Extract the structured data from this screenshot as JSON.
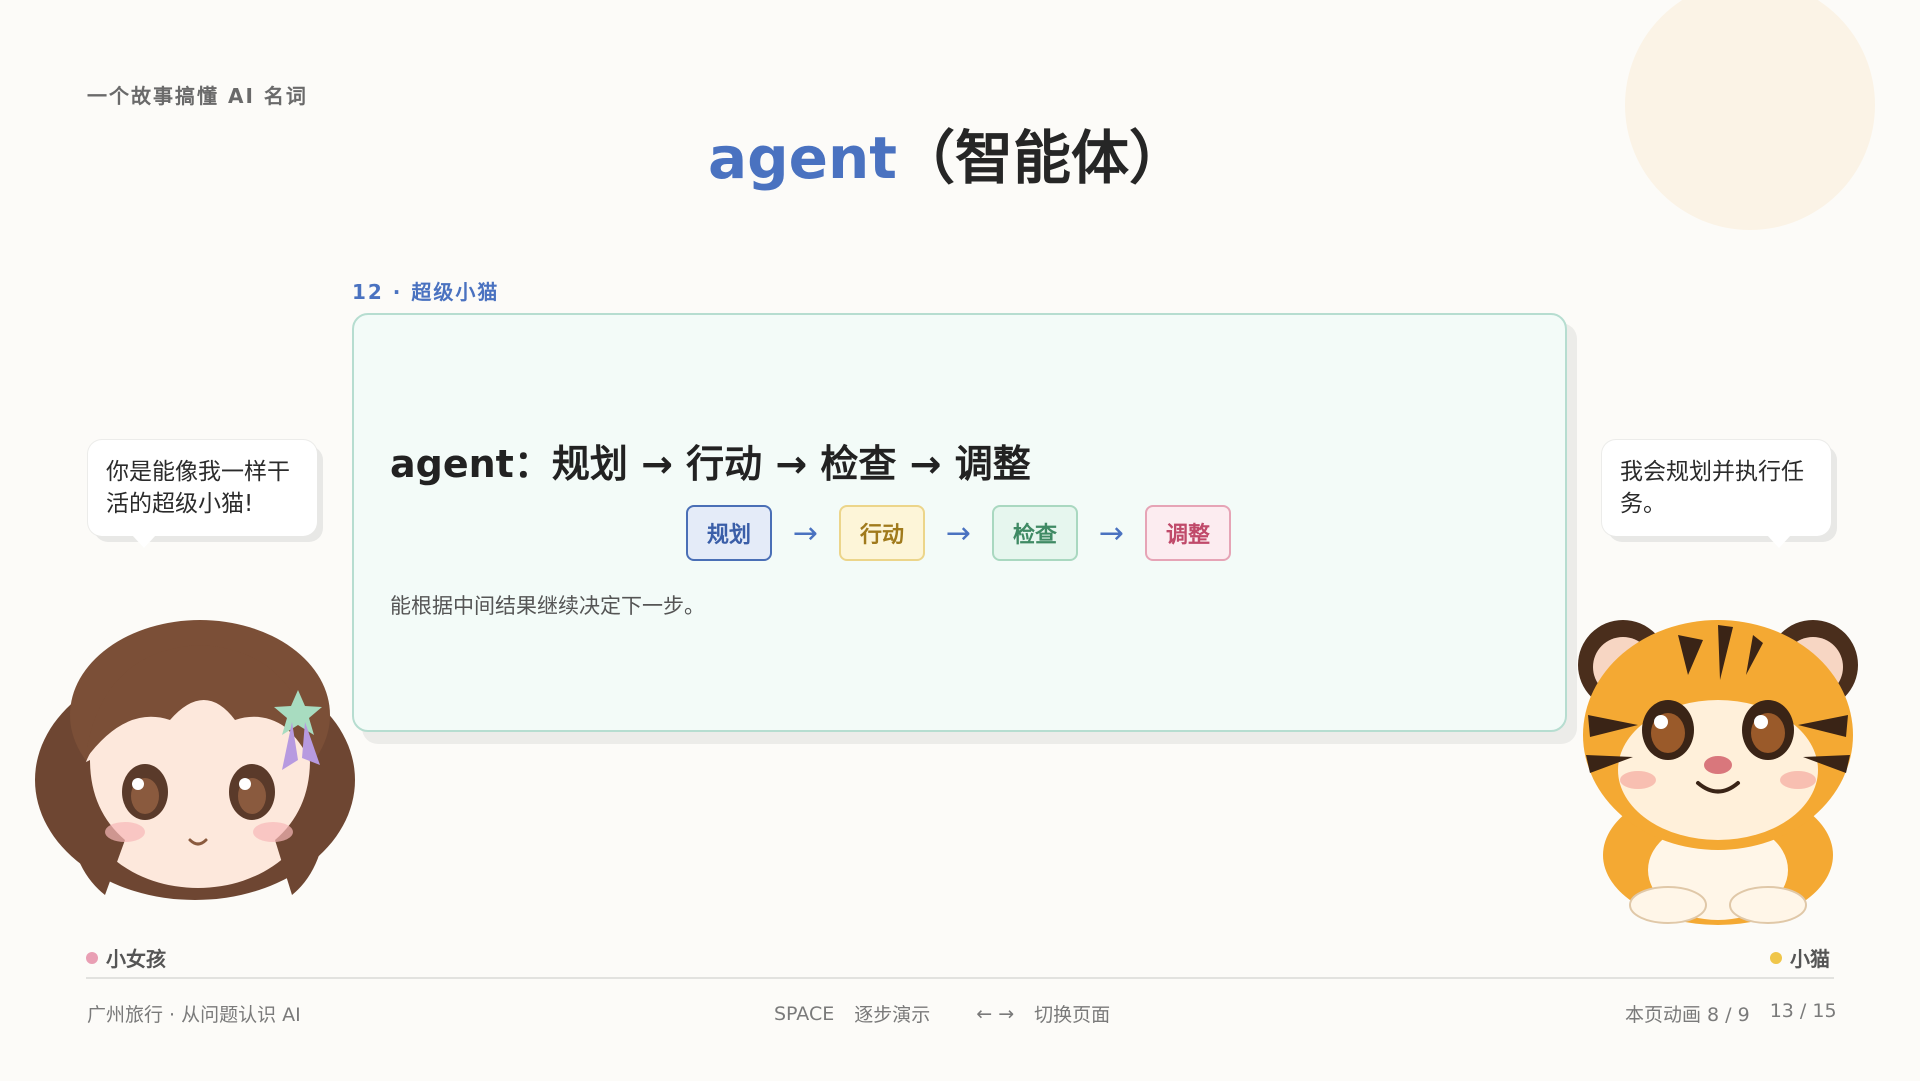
{
  "header": {
    "series": "一个故事搞懂 AI 名词",
    "title_term": "agent",
    "title_cn": "（智能体）"
  },
  "card": {
    "tag": "12 · 超级小猫",
    "heading": "agent：规划 → 行动 → 检查 → 调整",
    "steps": [
      "规划",
      "行动",
      "检查",
      "调整"
    ],
    "arrow": "→",
    "description": "能根据中间结果继续决定下一步。"
  },
  "dialogue": {
    "girl": "你是能像我一样干活的超级小猫!",
    "cat": "我会规划并执行任务。"
  },
  "characters": {
    "girl": "小女孩",
    "cat": "小猫"
  },
  "footer": {
    "course": "广州旅行 · 从问题认识 AI",
    "space_key": "SPACE",
    "space_action": "逐步演示",
    "arrows_keys": "← →",
    "arrows_action": "切换页面",
    "animation_progress": "本页动画 8 / 9",
    "page_progress": "13 / 15"
  },
  "colors": {
    "accent_blue": "#4a72c0",
    "card_border": "#b6ddd0",
    "step_plan": "#4a6fb6",
    "step_act": "#ecd58a",
    "step_check": "#a9d8c0",
    "step_adjust": "#e6a4b6",
    "girl_dot": "#e99fb4",
    "cat_dot": "#f0c64a"
  },
  "icons": {
    "girl_avatar": "chibi-girl-avatar",
    "cat_avatar": "tiger-cub-avatar"
  }
}
